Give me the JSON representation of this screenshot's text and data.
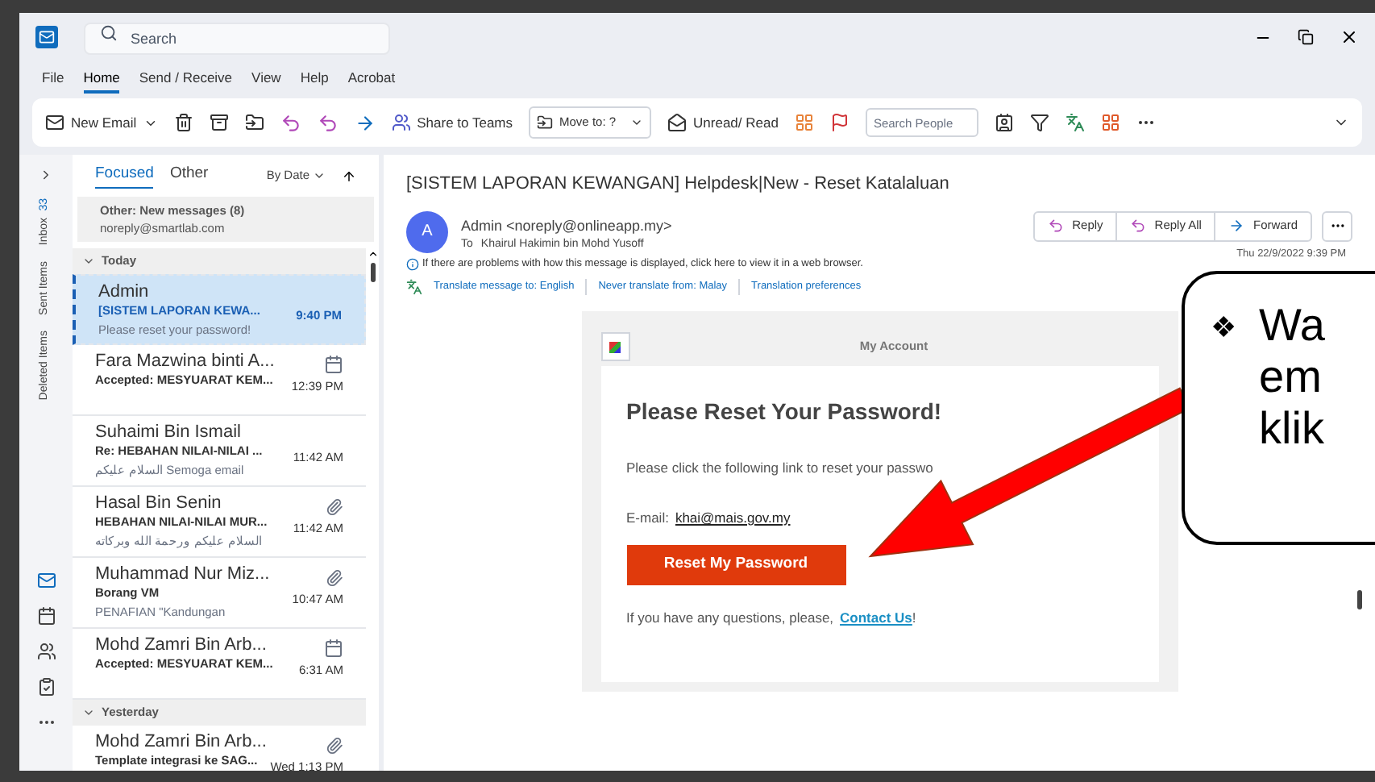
{
  "titlebar": {
    "search_placeholder": "Search"
  },
  "menu_tabs": [
    {
      "label": "File",
      "selected": false
    },
    {
      "label": "Home",
      "selected": true
    },
    {
      "label": "Send / Receive",
      "selected": false
    },
    {
      "label": "View",
      "selected": false
    },
    {
      "label": "Help",
      "selected": false
    },
    {
      "label": "Acrobat",
      "selected": false
    }
  ],
  "ribbon": {
    "new_email": "New Email",
    "share": "Share to Teams",
    "move_to": "Move to: ?",
    "unread": "Unread/ Read",
    "search_people_placeholder": "Search People"
  },
  "folders": [
    "Inbox",
    "Sent Items",
    "Deleted Items"
  ],
  "inbox_count": "33",
  "list": {
    "tabs": [
      {
        "label": "Focused",
        "selected": true
      },
      {
        "label": "Other",
        "selected": false
      }
    ],
    "sort": "By Date",
    "other_banner": {
      "title": "Other: New messages (8)",
      "sender": "noreply@smartlab.com"
    },
    "groups": [
      {
        "label": "Today",
        "messages": [
          {
            "sender": "Admin",
            "subject": "[SISTEM LAPORAN KEWA...",
            "preview": "Please reset your password!",
            "time": "9:40 PM",
            "kind": "plain",
            "selected": true
          },
          {
            "sender": "Fara Mazwina binti A...",
            "subject": "Accepted: MESYUARAT KEM...",
            "time": "12:39 PM",
            "kind": "meeting",
            "selected": false
          },
          {
            "sender": "Suhaimi Bin Ismail",
            "subject": "Re: HEBAHAN NILAI-NILAI ...",
            "preview": "السلام عليكم  Semoga email",
            "time": "11:42 AM",
            "kind": "plain",
            "selected": false
          },
          {
            "sender": "Hasal Bin Senin",
            "subject": "HEBAHAN NILAI-NILAI MUR...",
            "preview": "السلام عليكم ورحمة الله وبركاته",
            "time": "11:42 AM",
            "kind": "attachment",
            "selected": false
          },
          {
            "sender": "Muhammad Nur Miz...",
            "subject": "Borang VM",
            "preview": "PENAFIAN  \"Kandungan",
            "time": "10:47 AM",
            "kind": "attachment",
            "selected": false
          },
          {
            "sender": "Mohd Zamri Bin Arb...",
            "subject": "Accepted: MESYUARAT KEM...",
            "time": "6:31 AM",
            "kind": "meeting",
            "selected": false
          }
        ]
      },
      {
        "label": "Yesterday",
        "messages": [
          {
            "sender": "Mohd Zamri Bin Arb...",
            "subject": "Template integrasi ke SAG...",
            "time": "Wed 1:13 PM",
            "kind": "attachment",
            "selected": false
          }
        ]
      }
    ]
  },
  "email": {
    "subject": "[SISTEM LAPORAN KEWANGAN] Helpdesk|New - Reset Katalaluan",
    "avatar": "A",
    "from": "Admin <noreply@onlineapp.my>",
    "to_label": "To",
    "to": "Khairul Hakimin bin Mohd Yusoff",
    "actions": [
      "Reply",
      "Reply All",
      "Forward"
    ],
    "date": "Thu 22/9/2022 9:39 PM",
    "notice": "If there are problems with how this message is displayed, click here to view it in a web browser.",
    "translate": [
      "Translate message to: English",
      "Never translate from: Malay",
      "Translation preferences"
    ],
    "body": {
      "header": "My Account",
      "heading": "Please Reset Your Password!",
      "text": "Please click the following link to reset your passwo",
      "email_label": "E-mail:",
      "email": "khai@mais.gov.my",
      "button": "Reset My Password",
      "footer": "If you have any questions, please,",
      "contact": "Contact Us",
      "footer_end": "!"
    }
  },
  "callout": {
    "bullet": "❖",
    "lines": [
      "Wa",
      "em",
      "klik"
    ]
  }
}
